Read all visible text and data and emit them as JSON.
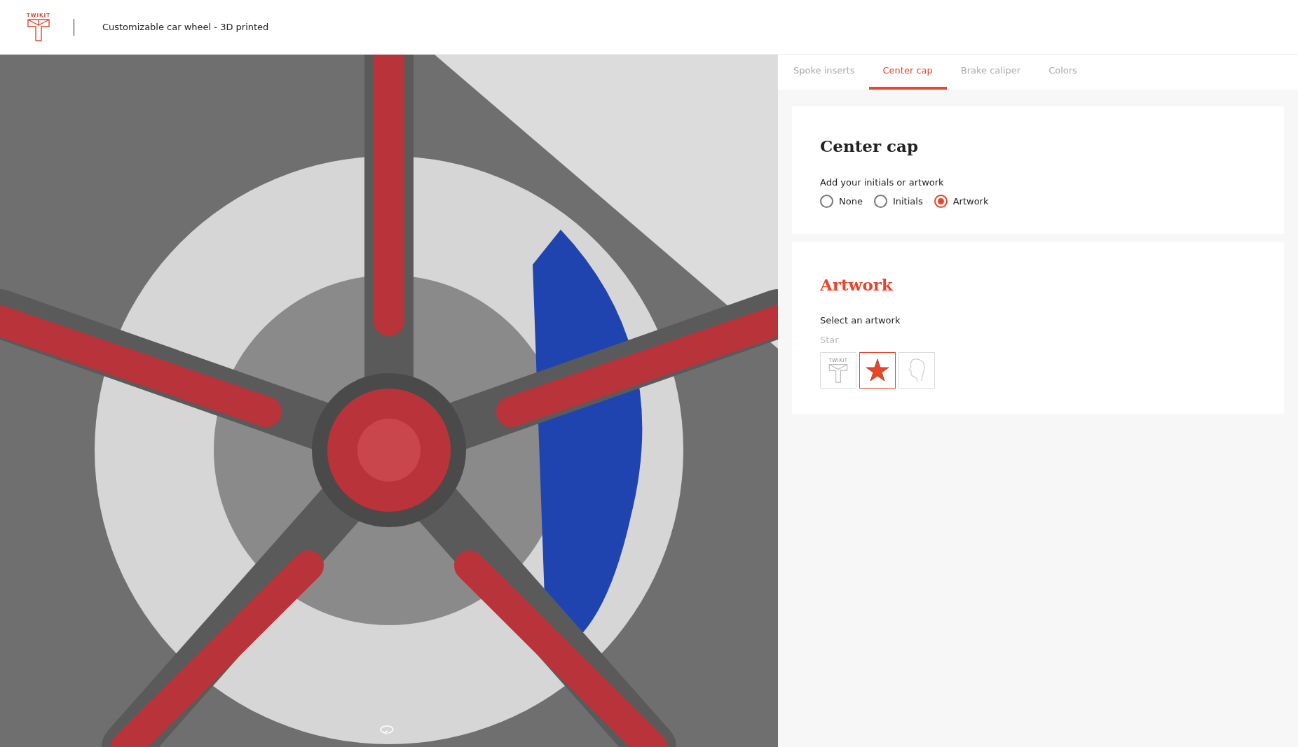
{
  "header": {
    "brand": "TWIKIT",
    "title": "Customizable car wheel - 3D printed"
  },
  "tabs": [
    {
      "label": "Spoke inserts",
      "selected": false
    },
    {
      "label": "Center cap",
      "selected": true
    },
    {
      "label": "Brake caliper",
      "selected": false
    },
    {
      "label": "Colors",
      "selected": false
    }
  ],
  "center_cap": {
    "title": "Center cap",
    "question": "Add your initials or artwork",
    "options": [
      {
        "label": "None",
        "selected": false
      },
      {
        "label": "Initials",
        "selected": false
      },
      {
        "label": "Artwork",
        "selected": true
      }
    ]
  },
  "artwork": {
    "title": "Artwork",
    "prompt": "Select an artwork",
    "current": "Star",
    "items": [
      {
        "kind": "logo",
        "text": "TWIKIT",
        "selected": false
      },
      {
        "kind": "star",
        "selected": true
      },
      {
        "kind": "head",
        "selected": false
      }
    ]
  }
}
